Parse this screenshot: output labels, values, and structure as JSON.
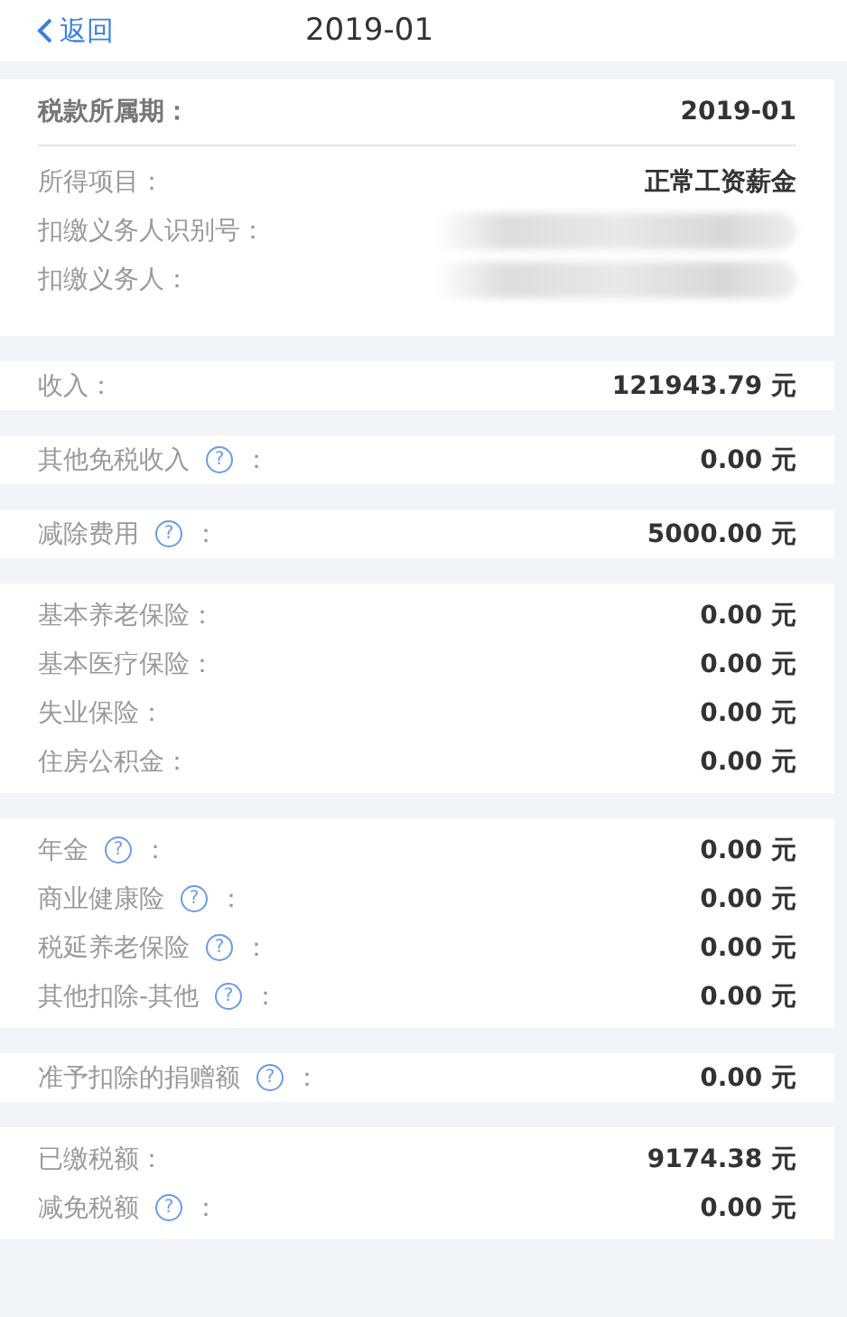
{
  "header": {
    "back": "返回",
    "title": "2019-01"
  },
  "sections": [
    {
      "rows": [
        {
          "kind": "period",
          "label": "税款所属期：",
          "value": "2019-01"
        },
        {
          "kind": "plain",
          "label": "所得项目：",
          "value": "正常工资薪金"
        },
        {
          "kind": "plain",
          "label": "扣缴义务人识别号：",
          "redacted": true
        },
        {
          "kind": "plain",
          "label": "扣缴义务人：",
          "redacted": true
        }
      ]
    },
    {
      "rows": [
        {
          "kind": "plain",
          "label": "收入：",
          "value": "121943.79 元"
        }
      ]
    },
    {
      "rows": [
        {
          "kind": "plain",
          "label": "其他免税收入",
          "help": "?",
          "label_end": "：",
          "value": "0.00 元"
        }
      ]
    },
    {
      "rows": [
        {
          "kind": "plain",
          "label": "减除费用",
          "help": "?",
          "label_end": "：",
          "value": "5000.00 元"
        }
      ]
    },
    {
      "rows": [
        {
          "kind": "plain",
          "label": "基本养老保险：",
          "value": "0.00 元"
        },
        {
          "kind": "plain",
          "label": "基本医疗保险：",
          "value": "0.00 元"
        },
        {
          "kind": "plain",
          "label": "失业保险：",
          "value": "0.00 元"
        },
        {
          "kind": "plain",
          "label": "住房公积金：",
          "value": "0.00 元"
        }
      ]
    },
    {
      "rows": [
        {
          "kind": "plain",
          "label": "年金",
          "help": "?",
          "label_end": "：",
          "value": "0.00 元"
        },
        {
          "kind": "plain",
          "label": "商业健康险",
          "help": "?",
          "label_end": "：",
          "value": "0.00 元"
        },
        {
          "kind": "plain",
          "label": "税延养老保险",
          "help": "?",
          "label_end": "：",
          "value": "0.00 元"
        },
        {
          "kind": "plain",
          "label": "其他扣除-其他",
          "help": "?",
          "label_end": "：",
          "value": "0.00 元"
        }
      ]
    },
    {
      "rows": [
        {
          "kind": "plain",
          "label": "准予扣除的捐赠额",
          "help": "?",
          "label_end": "：",
          "value": "0.00 元"
        }
      ]
    },
    {
      "rows": [
        {
          "kind": "plain",
          "label": "已缴税额：",
          "value": "9174.38 元"
        },
        {
          "kind": "plain",
          "label": "减免税额",
          "help": "?",
          "label_end": "：",
          "value": "0.00 元"
        }
      ]
    }
  ]
}
